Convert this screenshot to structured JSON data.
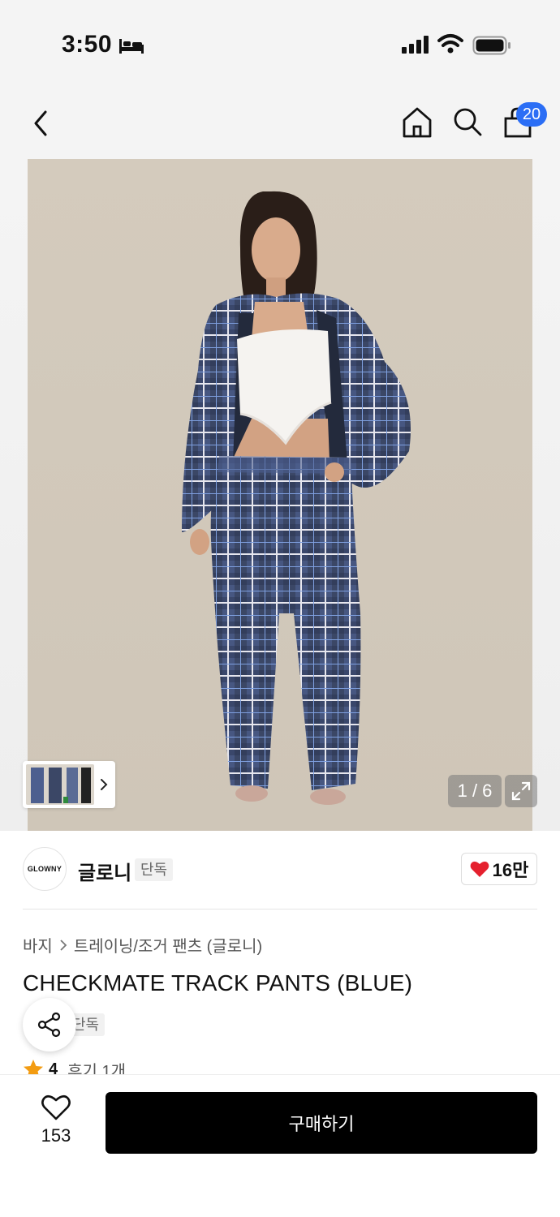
{
  "status_bar": {
    "time": "3:50",
    "icons": [
      "bed-icon",
      "signal-icon",
      "wifi-icon",
      "battery-icon"
    ]
  },
  "nav": {
    "cart_count": "20",
    "icons": [
      "back-icon",
      "home-icon",
      "search-icon",
      "cart-icon"
    ]
  },
  "gallery": {
    "page_indicator": "1 / 6",
    "current_page": 1,
    "total_pages": 6
  },
  "brand": {
    "logo_text": "GLOWNY",
    "name": "글로니",
    "tag": "단독",
    "likes": "16만"
  },
  "breadcrumb": {
    "items": [
      "바지",
      "트레이닝/조거 팬츠 (글로니)"
    ]
  },
  "product": {
    "title": "CHECKMATE TRACK PANTS (BLUE)",
    "tag": "단독",
    "rating": "4",
    "reviews": "후기 1개"
  },
  "bottom_bar": {
    "wish_count": "153",
    "buy_label": "구매하기"
  },
  "colors": {
    "accent_blue": "#2b6ef5",
    "heart_red": "#e5202e",
    "star_orange": "#f39c12",
    "buy_black": "#000000"
  }
}
